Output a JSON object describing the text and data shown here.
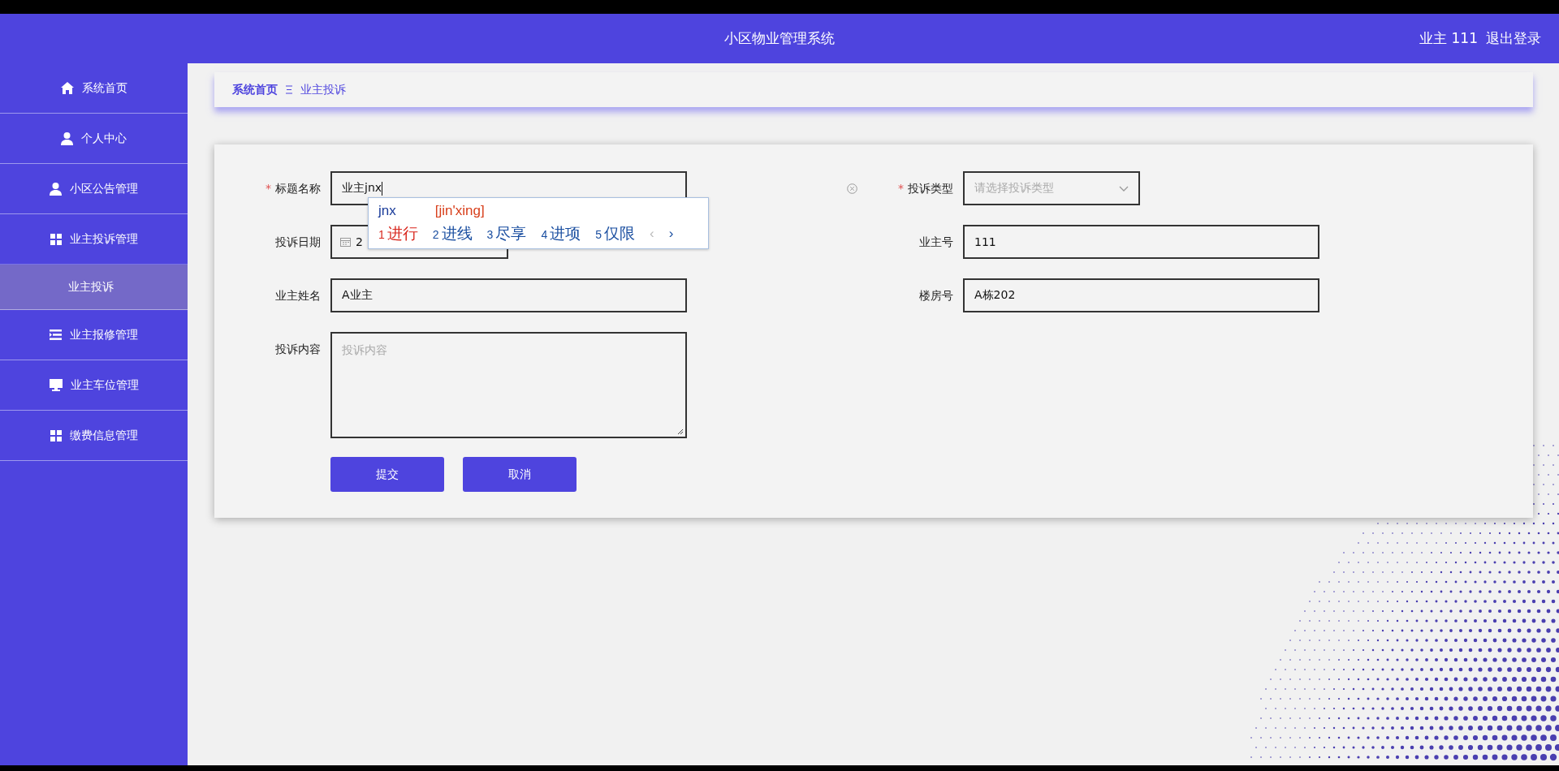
{
  "header": {
    "title": "小区物业管理系统",
    "user": "业主 111",
    "logout": "退出登录"
  },
  "sidebar": {
    "items": [
      {
        "kind": "home",
        "label": "系统首页",
        "selected": false
      },
      {
        "kind": "user",
        "label": "个人中心",
        "selected": false
      },
      {
        "kind": "user",
        "label": "小区公告管理",
        "selected": false
      },
      {
        "kind": "grid",
        "label": "业主投诉管理",
        "selected": false,
        "expanded": true,
        "children": [
          {
            "label": "业主投诉",
            "selected": true
          }
        ]
      },
      {
        "kind": "list",
        "label": "业主报修管理",
        "selected": false
      },
      {
        "kind": "monitor",
        "label": "业主车位管理",
        "selected": false
      },
      {
        "kind": "grid",
        "label": "缴费信息管理",
        "selected": false
      }
    ]
  },
  "breadcrumb": [
    {
      "label": "系统首页",
      "current": false
    },
    {
      "label": "业主投诉",
      "current": true
    }
  ],
  "form": {
    "rows": [
      {
        "left": {
          "kind": "text",
          "label": "标题名称",
          "required": true,
          "value": "业主jnx",
          "focused": true,
          "clearable": true
        },
        "right": {
          "kind": "select",
          "label": "投诉类型",
          "required": true,
          "placeholder": "请选择投诉类型"
        }
      },
      {
        "left": {
          "kind": "date",
          "label": "投诉日期",
          "value": "2"
        },
        "right": {
          "kind": "text",
          "label": "业主号",
          "value": "111"
        }
      },
      {
        "left": {
          "kind": "text",
          "label": "业主姓名",
          "value": "A业主"
        },
        "right": {
          "kind": "text",
          "label": "楼房号",
          "value": "A栋202"
        }
      },
      {
        "left": {
          "kind": "textarea",
          "label": "投诉内容",
          "placeholder": "投诉内容"
        }
      }
    ],
    "buttons": [
      "提交",
      "取消"
    ],
    "required_mark": "*"
  },
  "ime": {
    "composition": "jnx",
    "pinyin": "[jin'xing]",
    "candidates": [
      {
        "index": "1",
        "text": "进行",
        "selected": true
      },
      {
        "index": "2",
        "text": "进线",
        "selected": false
      },
      {
        "index": "3",
        "text": "尽享",
        "selected": false
      },
      {
        "index": "4",
        "text": "进项",
        "selected": false
      },
      {
        "index": "5",
        "text": "仅限",
        "selected": false
      }
    ],
    "prev": "‹",
    "next": "›"
  }
}
